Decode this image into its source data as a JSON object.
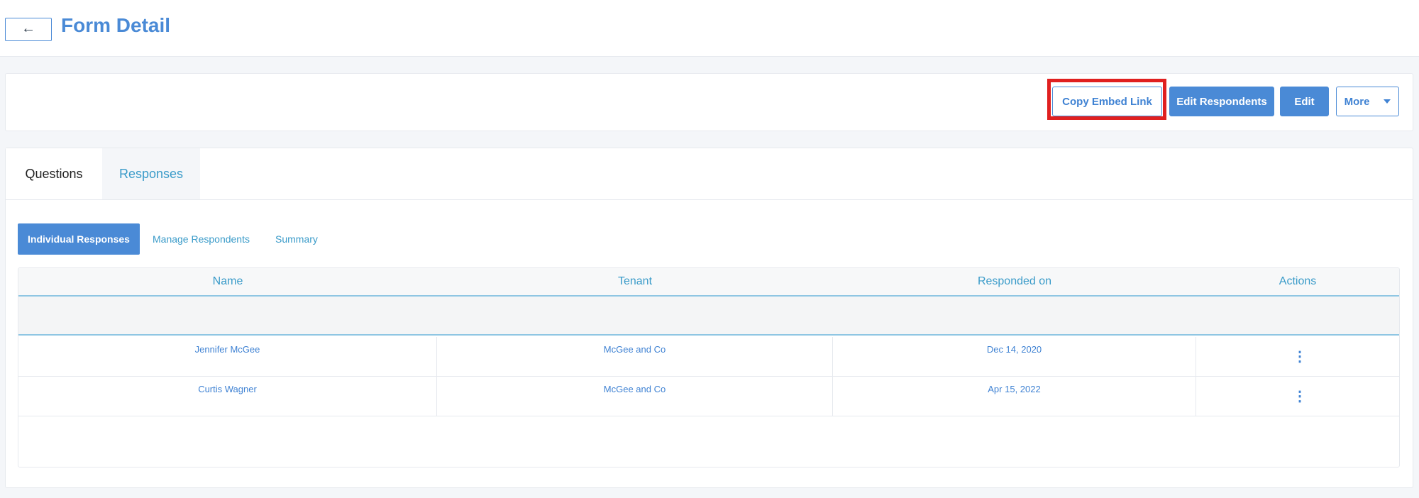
{
  "header": {
    "back_icon": "arrow-left-icon",
    "back_label": "←",
    "title": "Form Detail"
  },
  "toolbar": {
    "copy_embed_label": "Copy Embed Link",
    "edit_respondents_label": "Edit Respondents",
    "edit_label": "Edit",
    "more_label": "More",
    "more_icon": "caret-down-icon"
  },
  "tabs": [
    {
      "label": "Questions",
      "active": false
    },
    {
      "label": "Responses",
      "active": true
    }
  ],
  "subtabs": [
    {
      "label": "Individual Responses",
      "active": true
    },
    {
      "label": "Manage Respondents",
      "active": false
    },
    {
      "label": "Summary",
      "active": false
    }
  ],
  "table": {
    "columns": [
      "Name",
      "Tenant",
      "Responded on",
      "Actions"
    ],
    "rows": [
      {
        "name": "Jennifer McGee",
        "tenant": "McGee and Co",
        "responded_on": "Dec 14, 2020",
        "action_icon": "kebab-menu-icon"
      },
      {
        "name": "Curtis Wagner",
        "tenant": "McGee and Co",
        "responded_on": "Apr 15, 2022",
        "action_icon": "kebab-menu-icon"
      }
    ]
  },
  "colors": {
    "accent": "#4a8ad6",
    "link": "#3a9bc9",
    "highlight": "#e02020"
  }
}
